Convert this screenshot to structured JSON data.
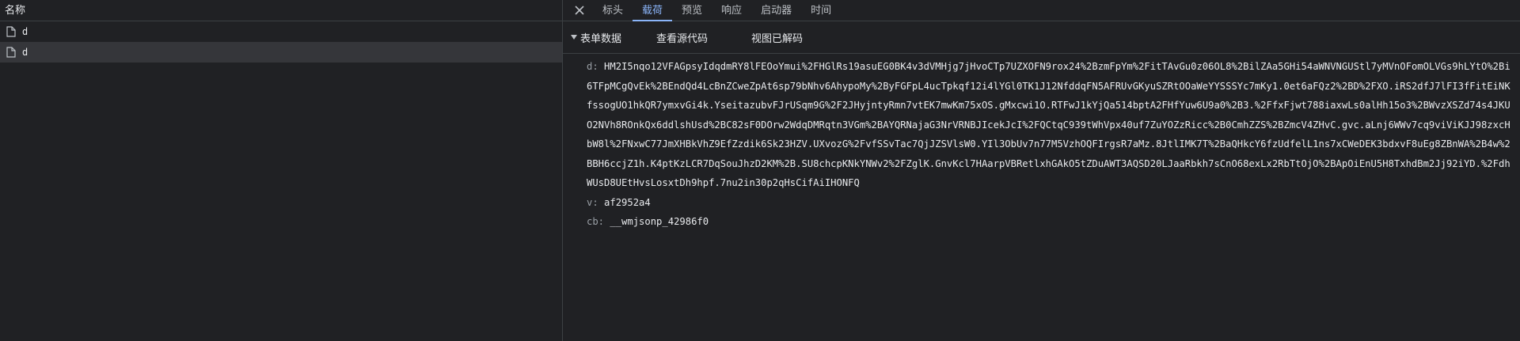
{
  "left_panel": {
    "header": "名称",
    "rows": [
      {
        "name": "d"
      },
      {
        "name": "d"
      }
    ]
  },
  "tabs": {
    "items": [
      "标头",
      "载荷",
      "预览",
      "响应",
      "启动器",
      "时间"
    ],
    "active_index": 1
  },
  "payload": {
    "section_title": "表单数据",
    "view_source": "查看源代码",
    "view_decoded": "视图已解码",
    "fields": [
      {
        "key": "d:",
        "value": "HM2I5nqo12VFAGpsyIdqdmRY8lFEOoYmui%2FHGlRs19asuEG0BK4v3dVMHjg7jHvoCTp7UZXOFN9rox24%2BzmFpYm%2FitTAvGu0z06OL8%2BilZAa5GHi54aWNVNGUStl7yMVnOFomOLVGs9hLYtO%2Bi6TFpMCgQvEk%2BEndQd4LcBnZCweZpAt6sp79bNhv6AhypoMy%2ByFGFpL4ucTpkqf12i4lYGl0TK1J12NfddqFN5AFRUvGKyuSZRtOOaWeYYSSSYc7mKy1.0et6aFQz2%2BD%2FXO.iRS2dfJ7lFI3fFitEiNKfssogUO1hkQR7ymxvGi4k.YseitazubvFJrUSqm9G%2F2JHyjntyRmn7vtEK7mwKm75xOS.gMxcwi1O.RTFwJ1kYjQa514bptA2FHfYuw6U9a0%2B3.%2FfxFjwt788iaxwLs0alHh15o3%2BWvzXSZd74s4JKUO2NVh8ROnkQx6ddlshUsd%2BC82sF0DOrw2WdqDMRqtn3VGm%2BAYQRNajaG3NrVRNBJIcekJcI%2FQCtqC939tWhVpx40uf7ZuYOZzRicc%2B0CmhZZS%2BZmcV4ZHvC.gvc.aLnj6WWv7cq9viViKJJ98zxcHbW8l%2FNxwC77JmXHBkVhZ9EfZzdik6Sk23HZV.UXvozG%2FvfSSvTac7QjJZSVlsW0.YIl3ObUv7n77M5VzhOQFIrgsR7aMz.8JtlIMK7T%2BaQHkcY6fzUdfelL1ns7xCWeDEK3bdxvF8uEg8ZBnWA%2B4w%2BBH6ccjZ1h.K4ptKzLCR7DqSouJhzD2KM%2B.SU8chcpKNkYNWv2%2FZglK.GnvKcl7HAarpVBRetlxhGAkO5tZDuAWT3AQSD20LJaaRbkh7sCnO68exLx2RbTtOjO%2BApOiEnU5H8TxhdBm2Jj92iYD.%2FdhWUsD8UEtHvsLosxtDh9hpf.7nu2in30p2qHsCifAiIHONFQ"
      },
      {
        "key": "v:",
        "value": "af2952a4"
      },
      {
        "key": "cb:",
        "value": "__wmjsonp_42986f0"
      }
    ]
  },
  "colors": {
    "background": "#202124",
    "accent": "#8ab4f8",
    "selected_row": "#35363a",
    "border": "#3c4043"
  }
}
